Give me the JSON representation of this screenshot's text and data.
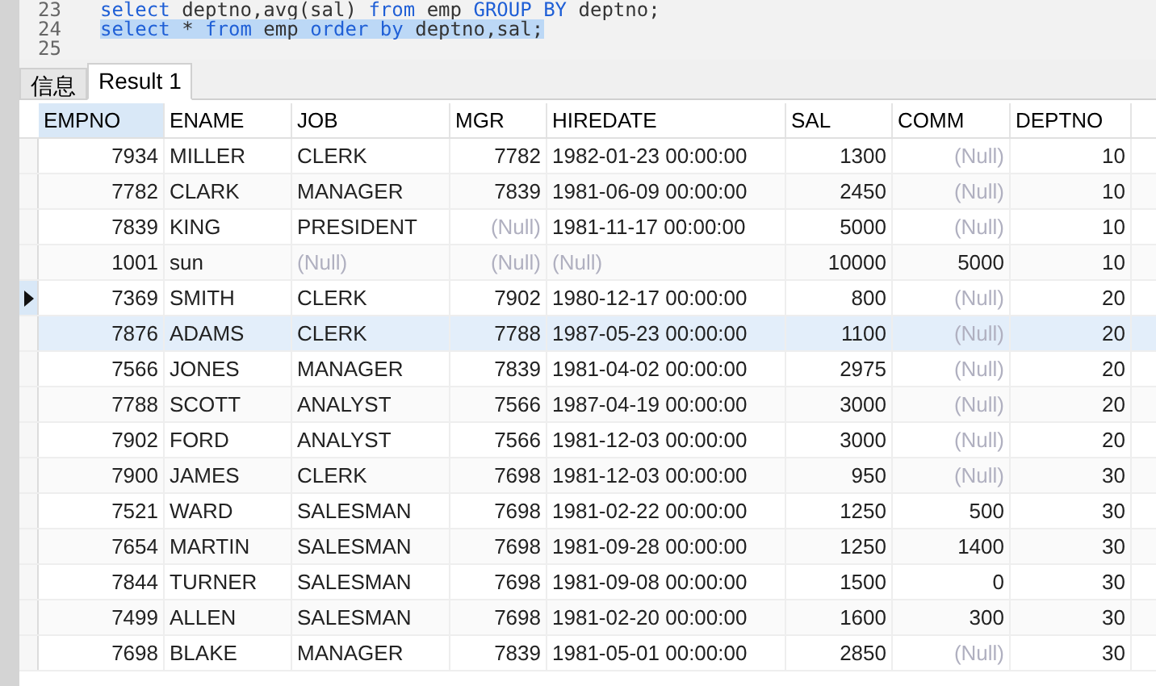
{
  "editor": {
    "lines": [
      {
        "number": "23",
        "selected": false,
        "tokens": [
          {
            "text": "select",
            "kind": "keyword"
          },
          {
            "text": " deptno,avg(sal) ",
            "kind": "plain"
          },
          {
            "text": "from",
            "kind": "keyword"
          },
          {
            "text": " emp ",
            "kind": "plain"
          },
          {
            "text": "GROUP BY",
            "kind": "keyword"
          },
          {
            "text": " deptno;",
            "kind": "plain"
          }
        ]
      },
      {
        "number": "24",
        "selected": true,
        "tokens": [
          {
            "text": "select",
            "kind": "keyword"
          },
          {
            "text": " * ",
            "kind": "plain"
          },
          {
            "text": "from",
            "kind": "keyword"
          },
          {
            "text": " emp ",
            "kind": "plain"
          },
          {
            "text": "order by",
            "kind": "keyword"
          },
          {
            "text": " deptno,sal;",
            "kind": "plain"
          }
        ]
      },
      {
        "number": "25"
      }
    ]
  },
  "tabs": [
    {
      "label": "信息",
      "selected": false
    },
    {
      "label": "Result 1",
      "selected": true
    }
  ],
  "table": {
    "columns": [
      {
        "label": "EMPNO",
        "selected": true
      },
      {
        "label": "ENAME",
        "selected": false
      },
      {
        "label": "JOB",
        "selected": false
      },
      {
        "label": "MGR",
        "selected": false
      },
      {
        "label": "HIREDATE",
        "selected": false
      },
      {
        "label": "SAL",
        "selected": false
      },
      {
        "label": "COMM",
        "selected": false
      },
      {
        "label": "DEPTNO",
        "selected": false
      }
    ],
    "rows": [
      {
        "selected": false,
        "hovered": false,
        "cells": [
          "7934",
          "MILLER",
          "CLERK",
          "7782",
          "1982-01-23 00:00:00",
          "1300",
          {
            "text": "(Null)",
            "null": true
          },
          "10"
        ]
      },
      {
        "selected": false,
        "hovered": false,
        "cells": [
          "7782",
          "CLARK",
          "MANAGER",
          "7839",
          "1981-06-09 00:00:00",
          "2450",
          {
            "text": "(Null)",
            "null": true
          },
          "10"
        ]
      },
      {
        "selected": false,
        "hovered": false,
        "cells": [
          "7839",
          "KING",
          "PRESIDENT",
          {
            "text": "(Null)",
            "null": true
          },
          "1981-11-17 00:00:00",
          "5000",
          {
            "text": "(Null)",
            "null": true
          },
          "10"
        ]
      },
      {
        "selected": false,
        "hovered": false,
        "cells": [
          "1001",
          "sun",
          {
            "text": "(Null)",
            "null": true
          },
          {
            "text": "(Null)",
            "null": true
          },
          {
            "text": "(Null)",
            "null": true
          },
          "10000",
          "5000",
          "10"
        ]
      },
      {
        "selected": true,
        "hovered": false,
        "cells": [
          "7369",
          "SMITH",
          "CLERK",
          "7902",
          "1980-12-17 00:00:00",
          "800",
          {
            "text": "(Null)",
            "null": true
          },
          "20"
        ]
      },
      {
        "selected": false,
        "hovered": true,
        "cells": [
          "7876",
          "ADAMS",
          "CLERK",
          "7788",
          "1987-05-23 00:00:00",
          "1100",
          {
            "text": "(Null)",
            "null": true
          },
          "20"
        ]
      },
      {
        "selected": false,
        "hovered": false,
        "cells": [
          "7566",
          "JONES",
          "MANAGER",
          "7839",
          "1981-04-02 00:00:00",
          "2975",
          {
            "text": "(Null)",
            "null": true
          },
          "20"
        ]
      },
      {
        "selected": false,
        "hovered": false,
        "cells": [
          "7788",
          "SCOTT",
          "ANALYST",
          "7566",
          "1987-04-19 00:00:00",
          "3000",
          {
            "text": "(Null)",
            "null": true
          },
          "20"
        ]
      },
      {
        "selected": false,
        "hovered": false,
        "cells": [
          "7902",
          "FORD",
          "ANALYST",
          "7566",
          "1981-12-03 00:00:00",
          "3000",
          {
            "text": "(Null)",
            "null": true
          },
          "20"
        ]
      },
      {
        "selected": false,
        "hovered": false,
        "cells": [
          "7900",
          "JAMES",
          "CLERK",
          "7698",
          "1981-12-03 00:00:00",
          "950",
          {
            "text": "(Null)",
            "null": true
          },
          "30"
        ]
      },
      {
        "selected": false,
        "hovered": false,
        "cells": [
          "7521",
          "WARD",
          "SALESMAN",
          "7698",
          "1981-02-22 00:00:00",
          "1250",
          "500",
          "30"
        ]
      },
      {
        "selected": false,
        "hovered": false,
        "cells": [
          "7654",
          "MARTIN",
          "SALESMAN",
          "7698",
          "1981-09-28 00:00:00",
          "1250",
          "1400",
          "30"
        ]
      },
      {
        "selected": false,
        "hovered": false,
        "cells": [
          "7844",
          "TURNER",
          "SALESMAN",
          "7698",
          "1981-09-08 00:00:00",
          "1500",
          "0",
          "30"
        ]
      },
      {
        "selected": false,
        "hovered": false,
        "cells": [
          "7499",
          "ALLEN",
          "SALESMAN",
          "7698",
          "1981-02-20 00:00:00",
          "1600",
          "300",
          "30"
        ]
      },
      {
        "selected": false,
        "hovered": false,
        "cells": [
          "7698",
          "BLAKE",
          "MANAGER",
          "7839",
          "1981-05-01 00:00:00",
          "2850",
          {
            "text": "(Null)",
            "null": true
          },
          "30"
        ]
      }
    ]
  }
}
